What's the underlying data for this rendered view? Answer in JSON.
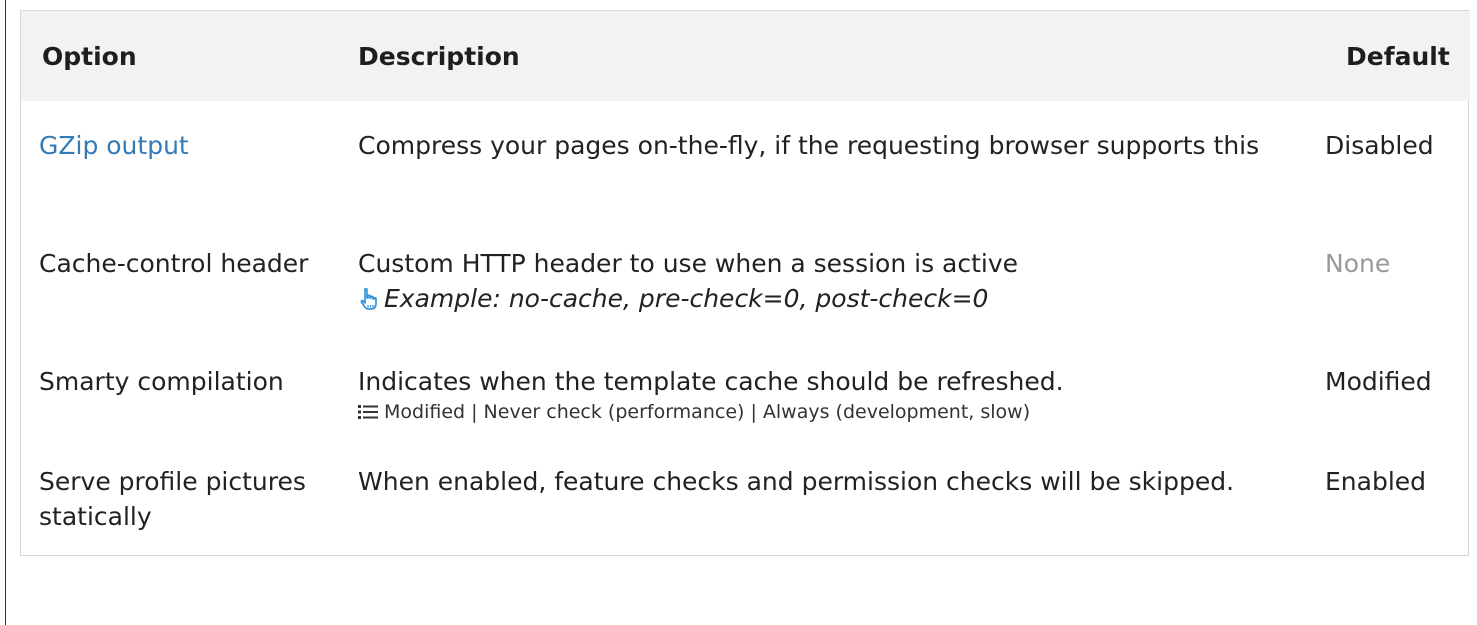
{
  "table": {
    "headers": {
      "option": "Option",
      "description": "Description",
      "default": "Default"
    },
    "rows": [
      {
        "option": "GZip output",
        "description": "Compress your pages on-the-fly, if the requesting browser supports this",
        "default": "Disabled"
      },
      {
        "option": "Cache-control header",
        "description": "Custom HTTP header to use when a session is active",
        "example": "Example: no-cache, pre-check=0, post-check=0",
        "example_icon": "pointing-hand-icon",
        "default": "None"
      },
      {
        "option": "Smarty compilation",
        "description": "Indicates when the template cache should be refreshed.",
        "options_list": "Modified | Never check (performance) | Always (development, slow)",
        "options_icon": "list-icon",
        "default": "Modified"
      },
      {
        "option": "Serve profile pictures statically",
        "description": "When enabled, feature checks and permission checks will be skipped.",
        "default": "Enabled"
      }
    ]
  },
  "colors": {
    "link": "#337ab7",
    "header_bg": "#f2f2f2",
    "muted": "#999999",
    "border": "#d6d6d6"
  }
}
